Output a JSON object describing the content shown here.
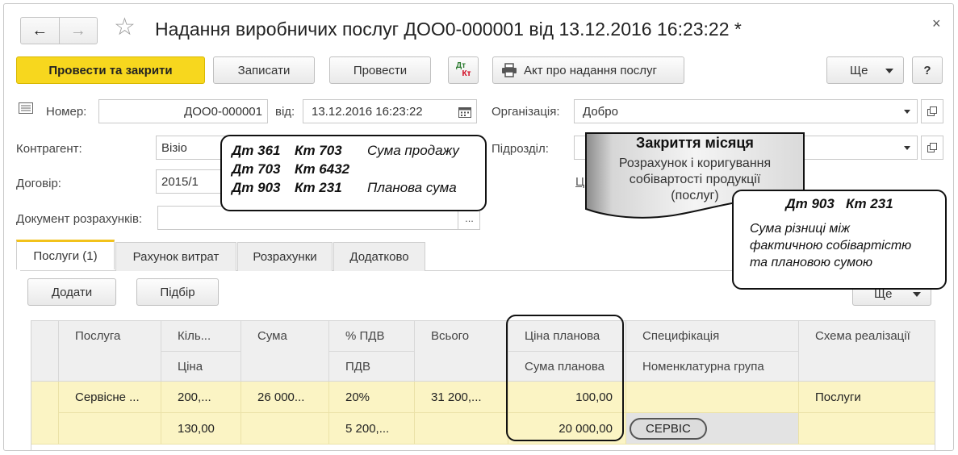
{
  "header": {
    "title": "Надання виробничих послуг ДОО0-000001 від 13.12.2016 16:23:22 *",
    "close_glyph": "×",
    "back_glyph": "←",
    "forward_glyph": "→",
    "star_glyph": "☆"
  },
  "toolbar": {
    "post_close": "Провести та закрити",
    "save": "Записати",
    "post": "Провести",
    "dt_label": "Дт",
    "kt_label": "Кт",
    "act": "Акт про надання послуг",
    "more": "Ще",
    "help": "?"
  },
  "form": {
    "number_label": "Номер:",
    "number_value": "ДОО0-000001",
    "date_label": "від:",
    "date_value": "13.12.2016 16:23:22",
    "org_label": "Організація:",
    "org_value": "Добро",
    "contractor_label": "Контрагент:",
    "contractor_value": "Візіо",
    "subdivision_label": "Підрозділ:",
    "contract_label": "Договір:",
    "contract_value": "2015/1",
    "settlement_label": "Документ розрахунків:",
    "dots": "...",
    "link_fragment": "Ц"
  },
  "tabs": [
    "Послуги (1)",
    "Рахунок витрат",
    "Розрахунки",
    "Додатково"
  ],
  "table_toolbar": {
    "add": "Додати",
    "select": "Підбір",
    "more": "Ще"
  },
  "table": {
    "headers_row1": [
      "Послуга",
      "Кіль...",
      "Сума",
      "% ПДВ",
      "Всього",
      "Ціна планова",
      "Специфікація",
      "Схема реалізації"
    ],
    "headers_row2": [
      "Ціна",
      "ПДВ",
      "Сума планова",
      "Номенклатурна група"
    ],
    "row1": {
      "service": "Сервісне ...",
      "qty": "200,...",
      "sum": "26 000...",
      "vat_rate": "20%",
      "total": "31 200,...",
      "plan_price": "100,00",
      "scheme": "Послуги"
    },
    "row2": {
      "price": "130,00",
      "vat": "5 200,...",
      "plan_sum": "20 000,00",
      "nomenclature_group": "СЕРВІС"
    }
  },
  "annotations": {
    "entries": [
      {
        "dt": "Дт 361",
        "kt": "Кт 703",
        "note": "Сума продажу"
      },
      {
        "dt": "Дт 703",
        "kt": "Кт 6432",
        "note": ""
      },
      {
        "dt": "Дт 903",
        "kt": "Кт 231",
        "note": "Планова сума"
      }
    ],
    "month_close_title": "Закриття місяця",
    "month_close_text": [
      "Розрахунок і коригування",
      "собівартості продукції",
      "(послуг)"
    ],
    "variance_entry": "Дт 903   Кт 231",
    "variance_text": [
      "Сума різниці між",
      "фактичною собівартістю",
      "та плановою сумою"
    ]
  },
  "colors": {
    "primary_button": "#f7d71e",
    "selected_row": "#fbf4c4",
    "header_cell": "#efefef",
    "active_tab_accent": "#f2c21b",
    "kt_red": "#d0021b",
    "dt_green": "#2e7d32"
  },
  "icons": [
    "back-arrow-icon",
    "forward-arrow-icon",
    "star-icon",
    "close-icon",
    "dt-kt-icon",
    "printer-icon",
    "dropdown-triangle-icon",
    "document-list-icon",
    "calendar-icon",
    "open-link-icon"
  ]
}
